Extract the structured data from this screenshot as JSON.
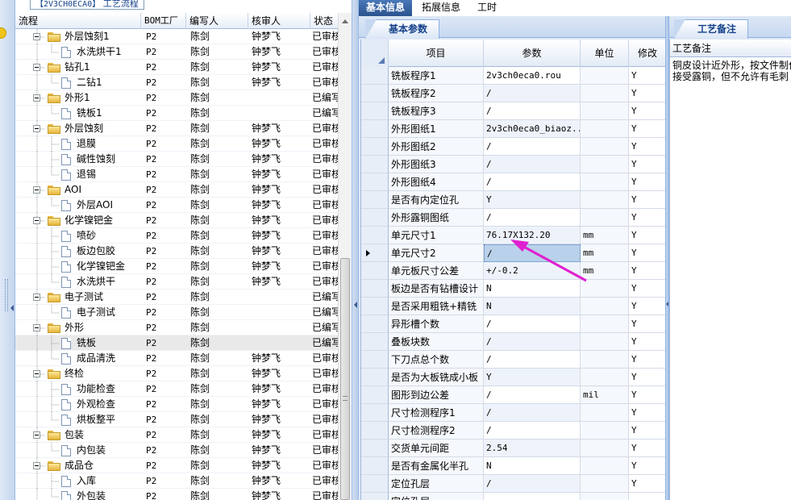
{
  "tree_panel": {
    "title_code": "【2V3CH0ECA0】",
    "title_label": "工艺流程",
    "columns": [
      "流程",
      "BOM工厂",
      "编写人",
      "核审人",
      "状态"
    ],
    "rows": [
      {
        "level": 1,
        "type": "folder",
        "name": "外层蚀刻1",
        "bom": "P2",
        "writer": "陈剑",
        "reviewer": "钟梦飞",
        "status": "已审核"
      },
      {
        "level": 2,
        "type": "doc",
        "name": "水洗烘干1",
        "bom": "P2",
        "writer": "陈剑",
        "reviewer": "钟梦飞",
        "status": "已审核"
      },
      {
        "level": 1,
        "type": "folder",
        "name": "钻孔1",
        "bom": "P2",
        "writer": "陈剑",
        "reviewer": "钟梦飞",
        "status": "已审核"
      },
      {
        "level": 2,
        "type": "doc",
        "name": "二钻1",
        "bom": "P2",
        "writer": "陈剑",
        "reviewer": "钟梦飞",
        "status": "已审核"
      },
      {
        "level": 1,
        "type": "folder",
        "name": "外形1",
        "bom": "P2",
        "writer": "陈剑",
        "reviewer": "",
        "status": "已编写"
      },
      {
        "level": 2,
        "type": "doc",
        "name": "铣板1",
        "bom": "P2",
        "writer": "陈剑",
        "reviewer": "",
        "status": "已编写"
      },
      {
        "level": 1,
        "type": "folder",
        "name": "外层蚀刻",
        "bom": "P2",
        "writer": "陈剑",
        "reviewer": "钟梦飞",
        "status": "已审核"
      },
      {
        "level": 2,
        "type": "doc",
        "name": "退膜",
        "bom": "P2",
        "writer": "陈剑",
        "reviewer": "钟梦飞",
        "status": "已审核"
      },
      {
        "level": 2,
        "type": "doc",
        "name": "碱性蚀刻",
        "bom": "P2",
        "writer": "陈剑",
        "reviewer": "钟梦飞",
        "status": "已审核"
      },
      {
        "level": 2,
        "type": "doc",
        "name": "退锡",
        "bom": "P2",
        "writer": "陈剑",
        "reviewer": "钟梦飞",
        "status": "已审核"
      },
      {
        "level": 1,
        "type": "folder",
        "name": "AOI",
        "bom": "P2",
        "writer": "陈剑",
        "reviewer": "钟梦飞",
        "status": "已审核"
      },
      {
        "level": 2,
        "type": "doc",
        "name": "外层AOI",
        "bom": "P2",
        "writer": "陈剑",
        "reviewer": "钟梦飞",
        "status": "已审核"
      },
      {
        "level": 1,
        "type": "folder",
        "name": "化学镍钯金",
        "bom": "P2",
        "writer": "陈剑",
        "reviewer": "钟梦飞",
        "status": "已审核"
      },
      {
        "level": 2,
        "type": "doc",
        "name": "喷砂",
        "bom": "P2",
        "writer": "陈剑",
        "reviewer": "钟梦飞",
        "status": "已审核"
      },
      {
        "level": 2,
        "type": "doc",
        "name": "板边包胶",
        "bom": "P2",
        "writer": "陈剑",
        "reviewer": "钟梦飞",
        "status": "已审核"
      },
      {
        "level": 2,
        "type": "doc",
        "name": "化学镍钯金",
        "bom": "P2",
        "writer": "陈剑",
        "reviewer": "钟梦飞",
        "status": "已审核"
      },
      {
        "level": 2,
        "type": "doc",
        "name": "水洗烘干",
        "bom": "P2",
        "writer": "陈剑",
        "reviewer": "钟梦飞",
        "status": "已审核"
      },
      {
        "level": 1,
        "type": "folder",
        "name": "电子测试",
        "bom": "P2",
        "writer": "陈剑",
        "reviewer": "",
        "status": "已编写"
      },
      {
        "level": 2,
        "type": "doc",
        "name": "电子测试",
        "bom": "P2",
        "writer": "陈剑",
        "reviewer": "",
        "status": "已编写"
      },
      {
        "level": 1,
        "type": "folder",
        "name": "外形",
        "bom": "P2",
        "writer": "陈剑",
        "reviewer": "",
        "status": "已编写"
      },
      {
        "level": 2,
        "type": "doc",
        "name": "铣板",
        "bom": "P2",
        "writer": "陈剑",
        "reviewer": "",
        "status": "已编写",
        "selected": true
      },
      {
        "level": 2,
        "type": "doc",
        "name": "成品清洗",
        "bom": "P2",
        "writer": "陈剑",
        "reviewer": "钟梦飞",
        "status": "已审核"
      },
      {
        "level": 1,
        "type": "folder",
        "name": "终检",
        "bom": "P2",
        "writer": "陈剑",
        "reviewer": "钟梦飞",
        "status": "已审核"
      },
      {
        "level": 2,
        "type": "doc",
        "name": "功能检查",
        "bom": "P2",
        "writer": "陈剑",
        "reviewer": "钟梦飞",
        "status": "已审核"
      },
      {
        "level": 2,
        "type": "doc",
        "name": "外观检查",
        "bom": "P2",
        "writer": "陈剑",
        "reviewer": "钟梦飞",
        "status": "已审核"
      },
      {
        "level": 2,
        "type": "doc",
        "name": "烘板整平",
        "bom": "P2",
        "writer": "陈剑",
        "reviewer": "钟梦飞",
        "status": "已审核"
      },
      {
        "level": 1,
        "type": "folder",
        "name": "包装",
        "bom": "P2",
        "writer": "陈剑",
        "reviewer": "钟梦飞",
        "status": "已审核"
      },
      {
        "level": 2,
        "type": "doc",
        "name": "内包装",
        "bom": "P2",
        "writer": "陈剑",
        "reviewer": "钟梦飞",
        "status": "已审核"
      },
      {
        "level": 1,
        "type": "folder",
        "name": "成品仓",
        "bom": "P2",
        "writer": "陈剑",
        "reviewer": "钟梦飞",
        "status": "已审核"
      },
      {
        "level": 2,
        "type": "doc",
        "name": "入库",
        "bom": "P2",
        "writer": "陈剑",
        "reviewer": "钟梦飞",
        "status": "已审核"
      },
      {
        "level": 2,
        "type": "doc",
        "name": "外包装",
        "bom": "P2",
        "writer": "陈剑",
        "reviewer": "钟梦飞",
        "status": "已审核"
      }
    ]
  },
  "top_tabs": [
    "基本信息",
    "拓展信息",
    "工时"
  ],
  "param_panel": {
    "tab_label": "基本参数",
    "columns": [
      "项目",
      "参数",
      "单位",
      "修改"
    ],
    "rows": [
      {
        "item": "铣板程序1",
        "param": "2v3ch0eca0.rou",
        "unit": "",
        "mod": "Y"
      },
      {
        "item": "铣板程序2",
        "param": "/",
        "unit": "",
        "mod": "Y"
      },
      {
        "item": "铣板程序3",
        "param": "/",
        "unit": "",
        "mod": "Y"
      },
      {
        "item": "外形图纸1",
        "param": "2v3ch0eca0_biaoz...",
        "unit": "",
        "mod": "Y"
      },
      {
        "item": "外形图纸2",
        "param": "/",
        "unit": "",
        "mod": "Y"
      },
      {
        "item": "外形图纸3",
        "param": "/",
        "unit": "",
        "mod": "Y"
      },
      {
        "item": "外形图纸4",
        "param": "/",
        "unit": "",
        "mod": "Y"
      },
      {
        "item": "是否有内定位孔",
        "param": "Y",
        "unit": "",
        "mod": "Y"
      },
      {
        "item": "外形露铜图纸",
        "param": "/",
        "unit": "",
        "mod": "Y"
      },
      {
        "item": "单元尺寸1",
        "param": "76.17X132.20",
        "unit": "mm",
        "mod": "Y"
      },
      {
        "item": "单元尺寸2",
        "param": "/",
        "unit": "mm",
        "mod": "Y",
        "current": true
      },
      {
        "item": "单元板尺寸公差",
        "param": "+/-0.2",
        "unit": "mm",
        "mod": "Y"
      },
      {
        "item": "板边是否有钻槽设计",
        "param": "N",
        "unit": "",
        "mod": "Y"
      },
      {
        "item": "是否采用粗铣+精铣",
        "param": "N",
        "unit": "",
        "mod": "Y"
      },
      {
        "item": "异形槽个数",
        "param": "/",
        "unit": "",
        "mod": "Y"
      },
      {
        "item": "叠板块数",
        "param": "/",
        "unit": "",
        "mod": "Y"
      },
      {
        "item": "下刀点总个数",
        "param": "/",
        "unit": "",
        "mod": "Y"
      },
      {
        "item": "是否为大板铣成小板",
        "param": "Y",
        "unit": "",
        "mod": "Y"
      },
      {
        "item": "图形到边公差",
        "param": "/",
        "unit": "mil",
        "mod": "Y"
      },
      {
        "item": "尺寸检测程序1",
        "param": "/",
        "unit": "",
        "mod": "Y"
      },
      {
        "item": "尺寸检测程序2",
        "param": "/",
        "unit": "",
        "mod": "Y"
      },
      {
        "item": "交货单元间距",
        "param": "2.54",
        "unit": "",
        "mod": "Y"
      },
      {
        "item": "是否有金属化半孔",
        "param": "N",
        "unit": "",
        "mod": "Y"
      },
      {
        "item": "定位孔层",
        "param": "/",
        "unit": "",
        "mod": "Y"
      },
      {
        "item": "定位孔层",
        "param": "",
        "unit": "",
        "mod": ""
      }
    ]
  },
  "notes_panel": {
    "tab_label": "工艺备注",
    "header": "工艺备注",
    "text": "铜皮设计近外形，按文件制作\n接受露铜，但不允许有毛刺"
  },
  "colors": {
    "accent": "#2a548f",
    "annotation": "#e020d0"
  }
}
